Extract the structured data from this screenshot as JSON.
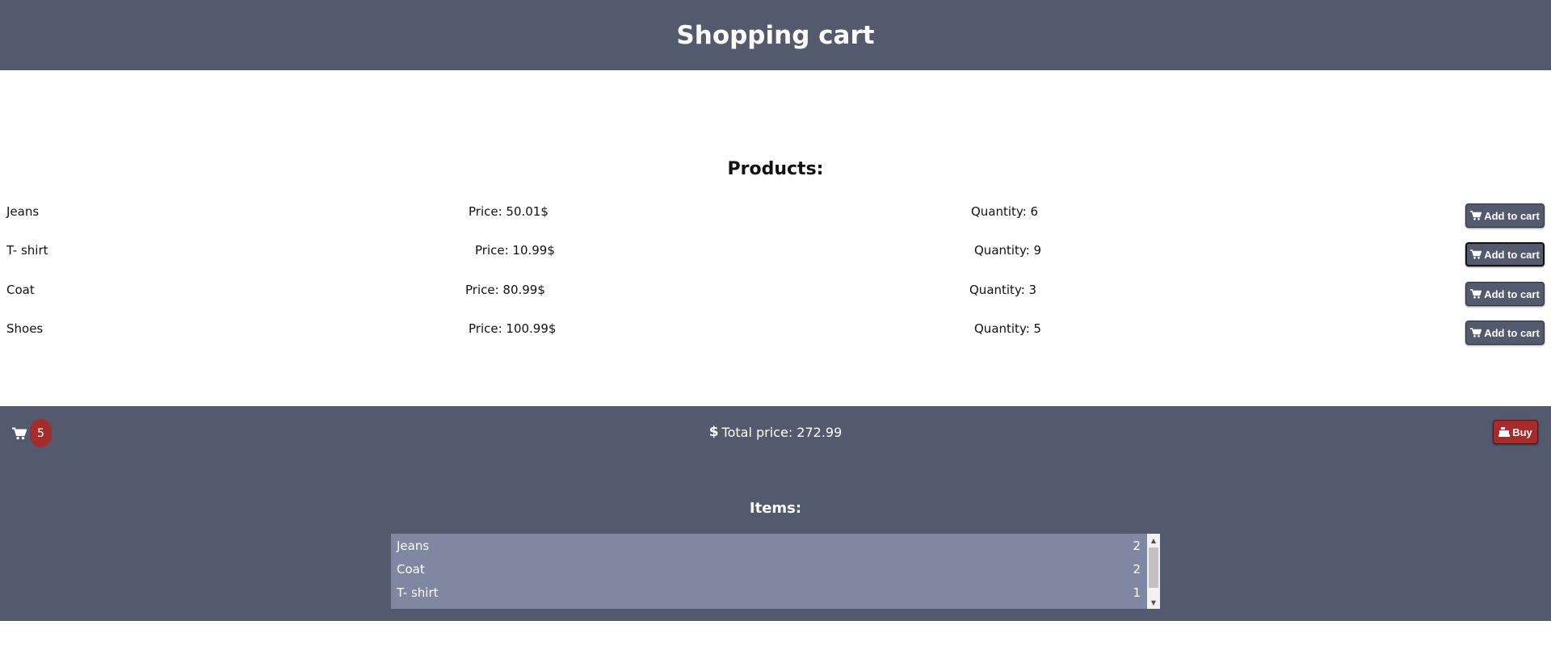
{
  "header": {
    "title": "Shopping cart"
  },
  "products": {
    "heading": "Products:",
    "items": [
      {
        "name": "Jeans",
        "price": "Price: 50.01$",
        "quantity": "Quantity: 6",
        "button": "Add to cart"
      },
      {
        "name": "T- shirt",
        "price": "Price: 10.99$",
        "quantity": "Quantity: 9",
        "button": "Add to cart"
      },
      {
        "name": "Coat",
        "price": "Price: 80.99$",
        "quantity": "Quantity: 3",
        "button": "Add to cart"
      },
      {
        "name": "Shoes",
        "price": "Price: 100.99$",
        "quantity": "Quantity: 5",
        "button": "Add to cart"
      }
    ]
  },
  "footer": {
    "cart_count": "5",
    "total": "Total price: 272.99",
    "buy_label": "Buy",
    "items_heading": "Items:",
    "items": [
      {
        "name": "Jeans",
        "qty": "2"
      },
      {
        "name": "Coat",
        "qty": "2"
      },
      {
        "name": "T- shirt",
        "qty": "1"
      }
    ]
  },
  "icons": {
    "cart": "shopping-cart-icon",
    "dollar": "dollar-icon",
    "buy": "cash-register-icon",
    "scroll_up": "scroll-up-arrow-icon",
    "scroll_down": "scroll-down-arrow-icon"
  },
  "colors": {
    "header_bg": "#535a6e",
    "badge": "#a62b2b",
    "list_bg": "#8088a1"
  }
}
